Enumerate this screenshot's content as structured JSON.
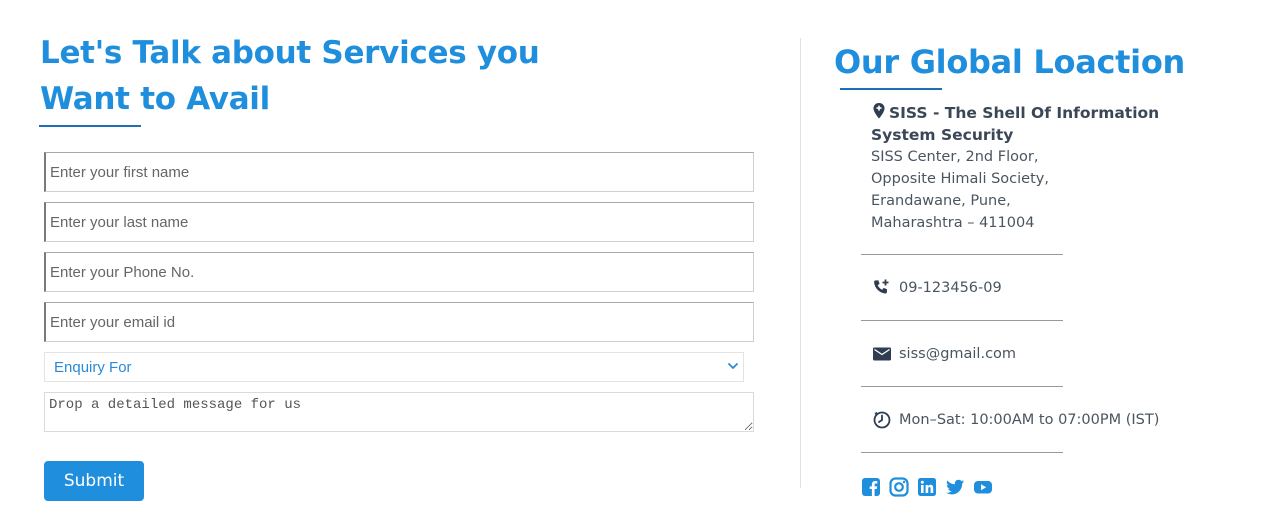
{
  "form": {
    "title": "Let's Talk about Services you Want to Avail",
    "first_name_placeholder": "Enter your first name",
    "last_name_placeholder": "Enter your last name",
    "phone_placeholder": "Enter your Phone No.",
    "email_placeholder": "Enter your email id",
    "enquiry_selected": "Enquiry For",
    "message_placeholder": "Drop a detailed message for us",
    "submit_label": "Submit"
  },
  "location": {
    "title": "Our Global Loaction",
    "company": "SISS - The Shell Of Information System Security",
    "address_lines": [
      "SISS Center, 2nd Floor,",
      "Opposite Himali Society,",
      "Erandawane, Pune,",
      "Maharashtra – 411004"
    ],
    "phone": "09-123456-09",
    "email": "siss@gmail.com",
    "hours": "Mon–Sat: 10:00AM to 07:00PM (IST)"
  },
  "icons": {
    "address": "location-pin-icon",
    "phone": "phone-plus-icon",
    "email": "envelope-icon",
    "hours": "clock-icon",
    "social": [
      "facebook-icon",
      "instagram-icon",
      "linkedin-icon",
      "twitter-icon",
      "youtube-icon"
    ]
  },
  "colors": {
    "accent": "#1f8fdd",
    "heading_underline": "#1f6fb8",
    "icon": "#2e3d52"
  }
}
